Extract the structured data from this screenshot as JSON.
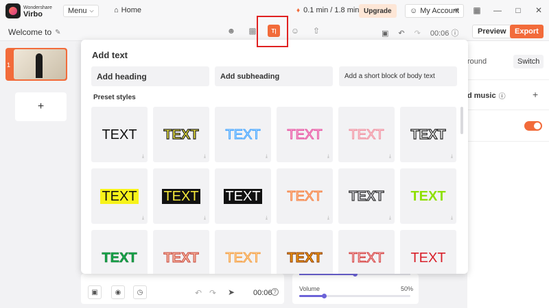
{
  "app": {
    "brand_line1": "Wondershare",
    "brand_line2": "Virbo",
    "menu_label": "Menu",
    "home_label": "Home",
    "usage": "0.1 min / 1.8 min",
    "upgrade_label": "Upgrade",
    "account_label": "My Account"
  },
  "toolbar": {
    "project_title": "Welcome to",
    "active_tool": "text-icon",
    "active_tool_glyph": "T|",
    "duration": "00:06",
    "preview_label": "Preview",
    "export_label": "Export"
  },
  "slides": {
    "items": [
      {
        "number": "1"
      }
    ],
    "add_label": "+"
  },
  "right_panel": {
    "background_label": "round",
    "switch_label": "Switch",
    "music_label": "d music",
    "music_add": "+"
  },
  "bottom": {
    "duration": "00:06",
    "volume_label": "Volume",
    "volume_pct": "50%",
    "volume_value": 50
  },
  "popup": {
    "title": "Add text",
    "add_heading": "Add heading",
    "add_subheading": "Add subheading",
    "add_body": "Add a short block of body text",
    "preset_label": "Preset styles",
    "presets": [
      {
        "text": "TEXT"
      },
      {
        "text": "TEXT"
      },
      {
        "text": "TEXT"
      },
      {
        "text": "TEXT"
      },
      {
        "text": "TEXT"
      },
      {
        "text": "TEXT"
      },
      {
        "text": "TEXT"
      },
      {
        "text": "TEXT"
      },
      {
        "text": "TEXT"
      },
      {
        "text": "TEXT"
      },
      {
        "text": "TEXT"
      },
      {
        "text": "TEXT"
      },
      {
        "text": "TEXT"
      },
      {
        "text": "TEXT"
      },
      {
        "text": "TEXT"
      },
      {
        "text": "TEXT"
      },
      {
        "text": "TEXT"
      },
      {
        "text": "TEXT"
      }
    ]
  },
  "colors": {
    "accent": "#f26b3a",
    "highlight": "#e02020",
    "slider": "#6c63d8"
  }
}
